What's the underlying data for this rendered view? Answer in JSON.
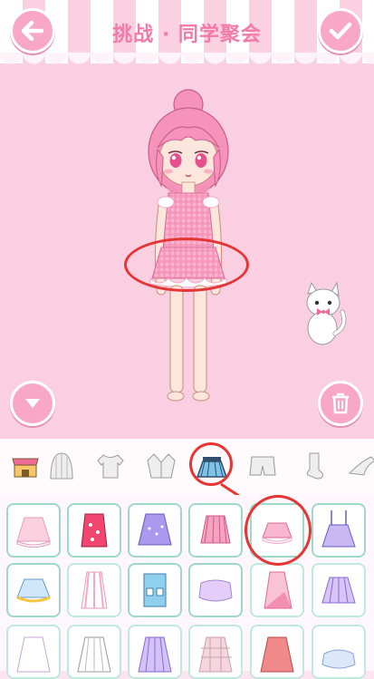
{
  "header": {
    "title": "挑战 · 同学聚会"
  },
  "icons": {
    "back": "arrow-left-icon",
    "confirm": "checkmark-icon",
    "collapse": "chevron-down-icon",
    "trash": "trash-icon",
    "pet": "cat-icon"
  },
  "categories": [
    {
      "name": "shop-icon"
    },
    {
      "name": "hair-icon"
    },
    {
      "name": "shirt-icon"
    },
    {
      "name": "jacket-icon"
    },
    {
      "name": "skirt-icon",
      "selected": true
    },
    {
      "name": "shorts-icon"
    },
    {
      "name": "sock-icon"
    },
    {
      "name": "shoe-icon"
    }
  ],
  "colors": {
    "accent": "#f37aa8",
    "button": "#f8a8c6",
    "annotation": "#e53535",
    "cell_border": "#bfe9dc"
  }
}
